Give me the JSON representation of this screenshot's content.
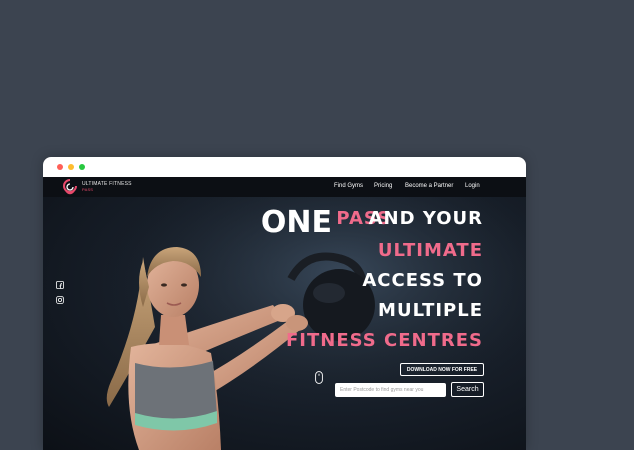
{
  "brand": {
    "name": "ULTIMATE FITNESS",
    "tagline": "PASS",
    "accent_color": "#e8496b"
  },
  "nav": {
    "items": [
      {
        "label": "Find Gyms"
      },
      {
        "label": "Pricing"
      },
      {
        "label": "Become a Partner"
      },
      {
        "label": "Login"
      }
    ]
  },
  "hero": {
    "one": "ONE",
    "pass": "PASS",
    "and_your": "AND YOUR",
    "ultimate": "ULTIMATE",
    "access_to": "ACCESS TO",
    "multiple": "MULTIPLE",
    "fitness_centres": "FITNESS CENTRES",
    "download_label": "DOWNLOAD NOW FOR FREE",
    "search_placeholder": "Enter Postcode to find gyms near you",
    "search_label": "Search"
  },
  "social": {
    "icons": [
      "facebook-icon",
      "instagram-icon"
    ]
  }
}
